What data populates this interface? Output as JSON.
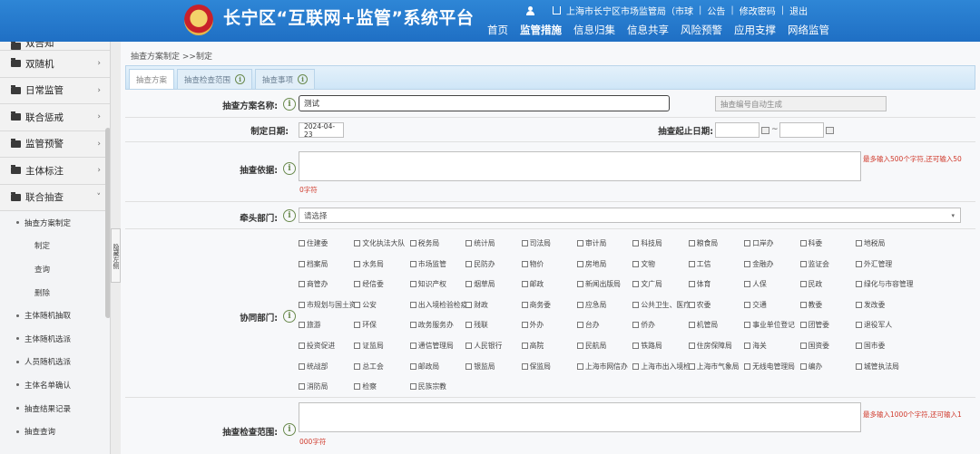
{
  "header": {
    "title": "长宁区“互联网+监管”系统平台",
    "user": "",
    "org": "上海市长宁区市场监管局（市球",
    "links": [
      "公告",
      "修改密码",
      "退出"
    ],
    "nav": [
      "首页",
      "监管措施",
      "信息归集",
      "信息共享",
      "风险预警",
      "应用支撑",
      "网络监管"
    ],
    "active_nav": "监管措施",
    "brand_color": "#2478cc"
  },
  "sidebar": {
    "cut_top": "双告知",
    "groups": [
      {
        "label": "双随机",
        "arrow": "›"
      },
      {
        "label": "日常监管",
        "arrow": "›"
      },
      {
        "label": "联合惩戒",
        "arrow": "›"
      },
      {
        "label": "监管预警",
        "arrow": "›"
      },
      {
        "label": "主体标注",
        "arrow": "›"
      },
      {
        "label": "联合抽查",
        "arrow": "˅"
      }
    ],
    "items": [
      {
        "label": "抽查方案制定"
      },
      {
        "label": "制定"
      },
      {
        "label": "查询"
      },
      {
        "label": "删除"
      },
      {
        "label": "主体随机抽取"
      },
      {
        "label": "主体随机选派"
      },
      {
        "label": "人员随机选派"
      },
      {
        "label": "主体名单确认"
      },
      {
        "label": "抽查结果记录"
      },
      {
        "label": "抽查查询"
      }
    ],
    "hide_label": "隐藏左侧"
  },
  "main": {
    "breadcrumb": "抽查方案制定 >>制定",
    "tabs": [
      "抽查方案",
      "抽查检查范围",
      "抽查事项"
    ],
    "form": {
      "plan_name_label": "抽查方案名称:",
      "plan_name_value": "测试",
      "plan_no_placeholder": "抽查编号自动生成",
      "date_label": "制定日期:",
      "date_value": "2024-04-23",
      "range_label": "抽查起止日期:",
      "range_sep": "~",
      "basis_label": "抽查依据:",
      "basis_hint": "最多输入500个字符,还可输入50",
      "basis_counter": "0字符",
      "lead_label": "牵头部门:",
      "lead_placeholder": "请选择",
      "coop_label": "协同部门:",
      "scope_label": "抽查检查范围:",
      "scope_hint": "最多输入1000个字符,还可输入1",
      "scope_counter": "000字符"
    },
    "departments": [
      [
        "住建委",
        "文化执法大队",
        "税务局",
        "统计局",
        "司法局",
        "审计局",
        "科技局",
        "粮食局",
        "口岸办",
        "科委",
        "地税局"
      ],
      [
        "档案局",
        "水务局",
        "市场监管",
        "民防办",
        "物价",
        "房地局",
        "文物",
        "工信",
        "金融办",
        "监证会",
        "外汇管理"
      ],
      [
        "商管办",
        "经信委",
        "知识产权",
        "烟草局",
        "邮政",
        "新闻出版局",
        "文广局",
        "体育",
        "人保",
        "民政",
        "绿化与市容管理"
      ],
      [
        "市规划与国土资",
        "公安",
        "出入境检验检疫",
        "财政",
        "商务委",
        "应急局",
        "公共卫生、医疗",
        "农委",
        "交通",
        "教委",
        "发改委"
      ],
      [
        "旅游",
        "环保",
        "政务服务办",
        "残联",
        "外办",
        "台办",
        "侨办",
        "机管局",
        "事业单位登记",
        "团管委",
        "退役军人"
      ],
      [
        "投资促进",
        "证监局",
        "通信管理局",
        "人民银行",
        "高院",
        "民航局",
        "铁路局",
        "住房保障局",
        "海关",
        "国资委",
        "国市委"
      ],
      [
        "统战部",
        "总工会",
        "邮政局",
        "银监局",
        "保监局",
        "上海市网信办",
        "上海市出入境检",
        "上海市气象局",
        "无线电管理局",
        "编办",
        "城管执法局"
      ],
      [
        "消防局",
        "检察",
        "民族宗教"
      ]
    ]
  }
}
